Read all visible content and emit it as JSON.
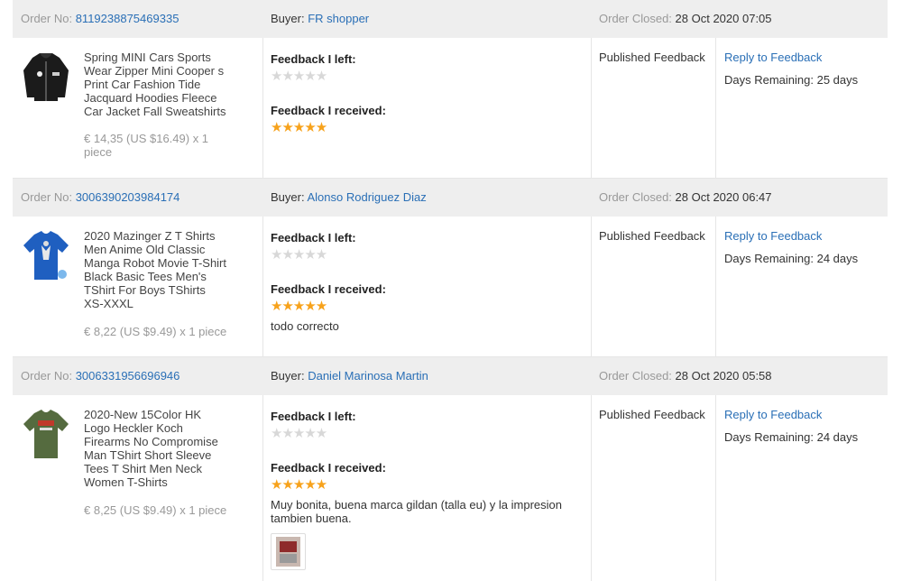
{
  "labels": {
    "order_no": "Order No:",
    "buyer": "Buyer:",
    "order_closed": "Order Closed:",
    "feedback_left": "Feedback I left:",
    "feedback_received": "Feedback I received:",
    "published": "Published Feedback",
    "reply": "Reply to Feedback"
  },
  "orders": [
    {
      "order_no": "8119238875469335",
      "buyer": "FR shopper",
      "closed": "28 Oct 2020 07:05",
      "title": "Spring MINI Cars Sports Wear Zipper Mini Cooper s Print Car Fashion Tide Jacquard Hoodies Fleece Car Jacket Fall Sweatshirts",
      "price": "€ 14,35 (US $16.49) x 1 piece",
      "stars_left": "★★★★★",
      "stars_received": "★★★★★",
      "rating_received": 5,
      "comment": "",
      "days_remaining": "Days Remaining: 25 days",
      "thumb_icon": "black-hoodie-icon"
    },
    {
      "order_no": "3006390203984174",
      "buyer": "Alonso Rodriguez Diaz",
      "closed": "28 Oct 2020 06:47",
      "title": "2020 Mazinger Z T Shirts Men Anime Old Classic Manga Robot Movie T-Shirt Black Basic Tees Men's TShirt For Boys TShirts XS-XXXL",
      "price": "€ 8,22 (US $9.49) x 1 piece",
      "stars_left": "★★★★★",
      "stars_received": "★★★★★",
      "rating_received": 5,
      "comment": "todo correcto",
      "days_remaining": "Days Remaining: 24 days",
      "thumb_icon": "blue-tshirt-icon"
    },
    {
      "order_no": "3006331956696946",
      "buyer": "Daniel Marinosa Martin",
      "closed": "28 Oct 2020 05:58",
      "title": "2020-New 15Color HK Logo Heckler Koch Firearms No Compromise Man TShirt Short Sleeve Tees T Shirt Men Neck Women T-Shirts",
      "price": "€ 8,25 (US $9.49) x 1 piece",
      "stars_left": "★★★★★",
      "stars_received": "★★★★★",
      "rating_received": 5,
      "comment": "Muy bonita, buena marca gildan (talla eu) y la impresion tambien buena.",
      "days_remaining": "Days Remaining: 24 days",
      "thumb_icon": "olive-tshirt-icon"
    }
  ],
  "colors": {
    "link": "#2a6fb6",
    "star_filled": "#f7a21b",
    "star_empty": "#d8d8d8",
    "header_bg": "#eeeeee"
  }
}
